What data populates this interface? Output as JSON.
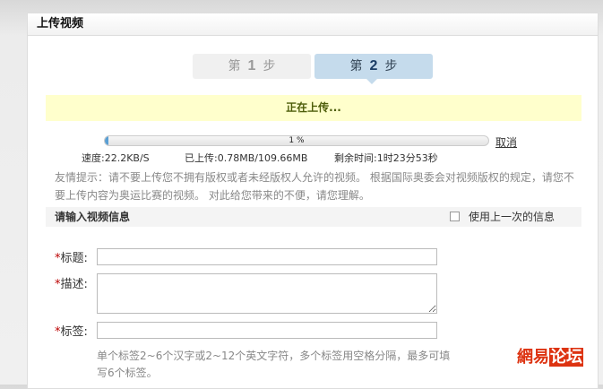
{
  "header": {
    "title": "上传视频"
  },
  "steps": [
    {
      "pre": "第",
      "num": "1",
      "post": "步"
    },
    {
      "pre": "第",
      "num": "2",
      "post": "步"
    }
  ],
  "status": "正在上传...",
  "progress": {
    "percent": 1,
    "label": "1 %",
    "cancel": "取消"
  },
  "stats": {
    "speed": "速度:22.2KB/S",
    "uploaded": "已上传:0.78MB/109.66MB",
    "remaining": "剩余时间:1时23分53秒"
  },
  "tip": "友情提示：请不要上传您不拥有版权或者未经版权人允许的视频。 根据国际奥委会对视频版权的规定，请您不要上传内容为奥运比赛的视频。 对此给您带来的不便，请您理解。",
  "section": {
    "title": "请输入视频信息",
    "use_last": "使用上一次的信息"
  },
  "form": {
    "required": "*",
    "title_label": "标题:",
    "desc_label": "描述:",
    "tags_label": "标签:",
    "title_value": "",
    "desc_value": "",
    "tags_value": "",
    "tags_hint": "单个标签2~6个汉字或2~12个英文字符，多个标签用空格分隔，最多可填写6个标签。"
  },
  "watermark": {
    "a": "網易",
    "b": "论坛"
  }
}
